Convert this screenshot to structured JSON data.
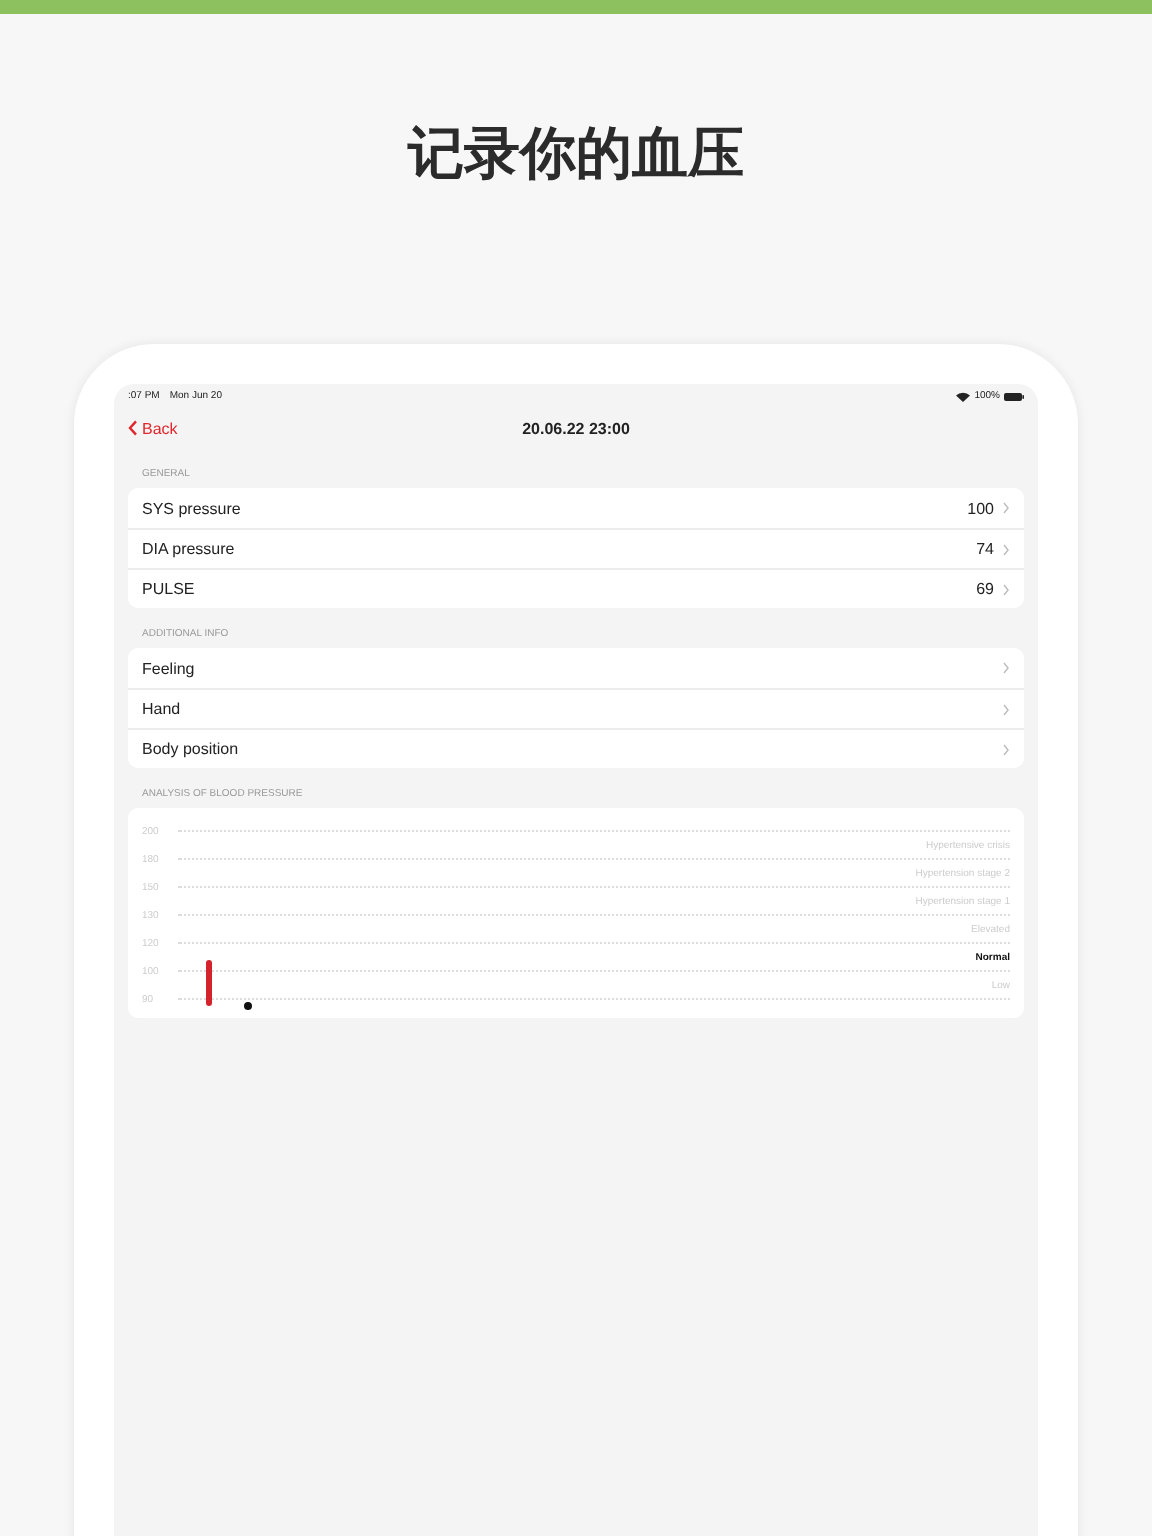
{
  "headline": "记录你的血压",
  "status_bar": {
    "time": ":07 PM",
    "date": "Mon Jun 20",
    "battery": "100%"
  },
  "nav": {
    "back": "Back",
    "title": "20.06.22 23:00"
  },
  "sections": [
    {
      "header": "GENERAL",
      "rows": [
        {
          "label": "SYS pressure",
          "value": "100"
        },
        {
          "label": "DIA pressure",
          "value": "74"
        },
        {
          "label": "PULSE",
          "value": "69"
        }
      ]
    },
    {
      "header": "ADDITIONAL INFO",
      "rows": [
        {
          "label": "Feeling"
        },
        {
          "label": "Hand"
        },
        {
          "label": "Body position"
        }
      ]
    }
  ],
  "analysis": {
    "header": "ANALYSIS OF BLOOD PRESSURE",
    "y_labels": [
      "200",
      "180",
      "150",
      "130",
      "120",
      "100",
      "90"
    ],
    "bands": [
      {
        "label": "Hypertensive crisis",
        "selected": false
      },
      {
        "label": "Hypertension stage 2",
        "selected": false
      },
      {
        "label": "Hypertension stage 1",
        "selected": false
      },
      {
        "label": "Elevated",
        "selected": false
      },
      {
        "label": "Normal",
        "selected": true
      },
      {
        "label": "Low",
        "selected": false
      }
    ]
  }
}
